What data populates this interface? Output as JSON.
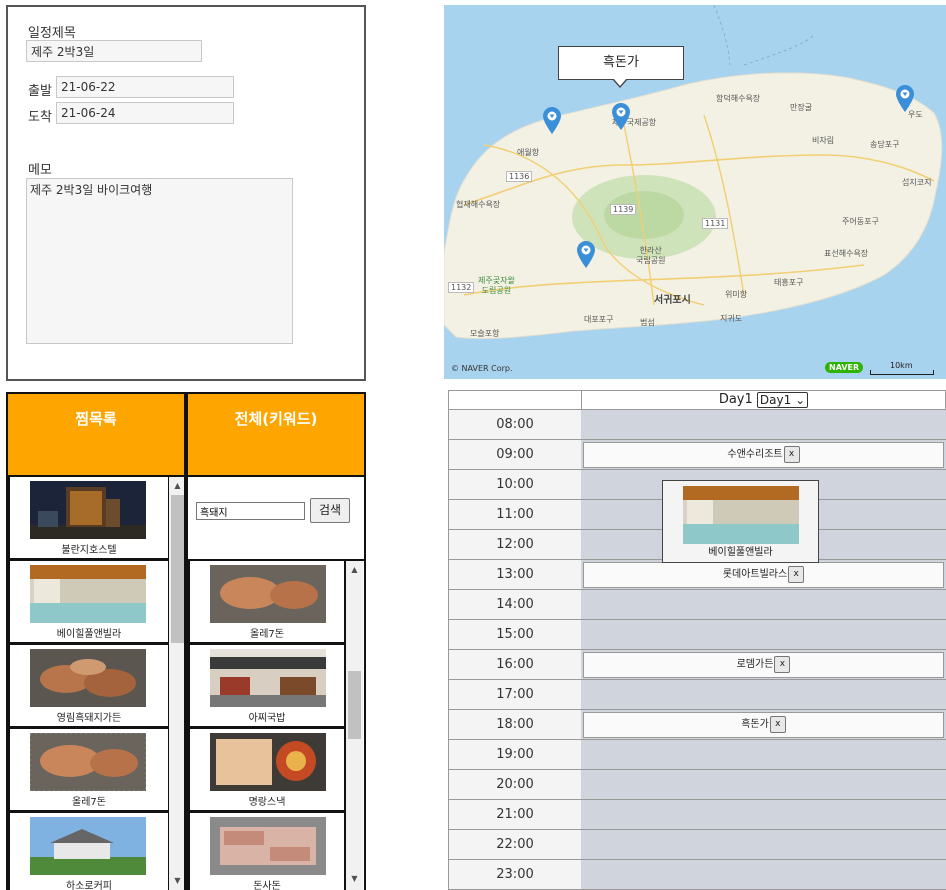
{
  "trip": {
    "title_label": "일정제목",
    "title_value": "제주 2박3일",
    "depart_label": "출발",
    "depart_value": "21-06-22",
    "arrive_label": "도착",
    "arrive_value": "21-06-24",
    "memo_label": "메모",
    "memo_value": "제주 2박3일 바이크여행"
  },
  "map": {
    "callout": "흑돈가",
    "copyright": "© NAVER Corp.",
    "brand": "NAVER",
    "scale": "10km",
    "labels": {
      "l1": "애월항",
      "l2": "제주국제공항",
      "l3": "함덕해수욕장",
      "l4": "만장굴",
      "l5": "비자림",
      "l6": "송당포구",
      "l7": "섭지코지",
      "l8": "우도",
      "l9": "협재해수욕장",
      "l10": "주어동포구",
      "l11": "표선해수욕장",
      "l12": "한라산\n국립공원",
      "l13": "제주곶자왈\n도립공원",
      "l14": "서귀포시",
      "l15": "위미항",
      "l16": "태흥포구",
      "l17": "대포포구",
      "l18": "범섬",
      "l19": "지귀도",
      "l20": "모슬포항",
      "r1": "1136",
      "r2": "1139",
      "r3": "1131",
      "r4": "1132"
    }
  },
  "wishlist": {
    "title": "찜목록",
    "items": [
      "불란지호스텔",
      "베이힐풀앤빌라",
      "영림흑돼지가든",
      "올레7돈",
      "하소로커피"
    ]
  },
  "search": {
    "title": "전체(키워드)",
    "keyword": "흑돼지",
    "button": "검색",
    "results": [
      "올레7돈",
      "아찌국밥",
      "명랑스낵",
      "돈사돈"
    ]
  },
  "schedule": {
    "day_label": "Day1",
    "day_select": "Day1",
    "times": [
      "08:00",
      "09:00",
      "10:00",
      "11:00",
      "12:00",
      "13:00",
      "14:00",
      "15:00",
      "16:00",
      "17:00",
      "18:00",
      "19:00",
      "20:00",
      "21:00",
      "22:00",
      "23:00"
    ],
    "events": [
      {
        "name": "수앤수리조트",
        "x": "x"
      },
      {
        "name": "롯데아트빌라스",
        "x": "x"
      },
      {
        "name": "로뎀가든",
        "x": "x"
      },
      {
        "name": "흑돈가",
        "x": "x"
      }
    ],
    "dragging": "베이힐풀앤빌라"
  },
  "colors": {
    "panel_header": "#ffa500",
    "slot_bg": "#cfd4dd",
    "map_sea": "#a8d3ef",
    "pin": "#3b8fd8"
  }
}
